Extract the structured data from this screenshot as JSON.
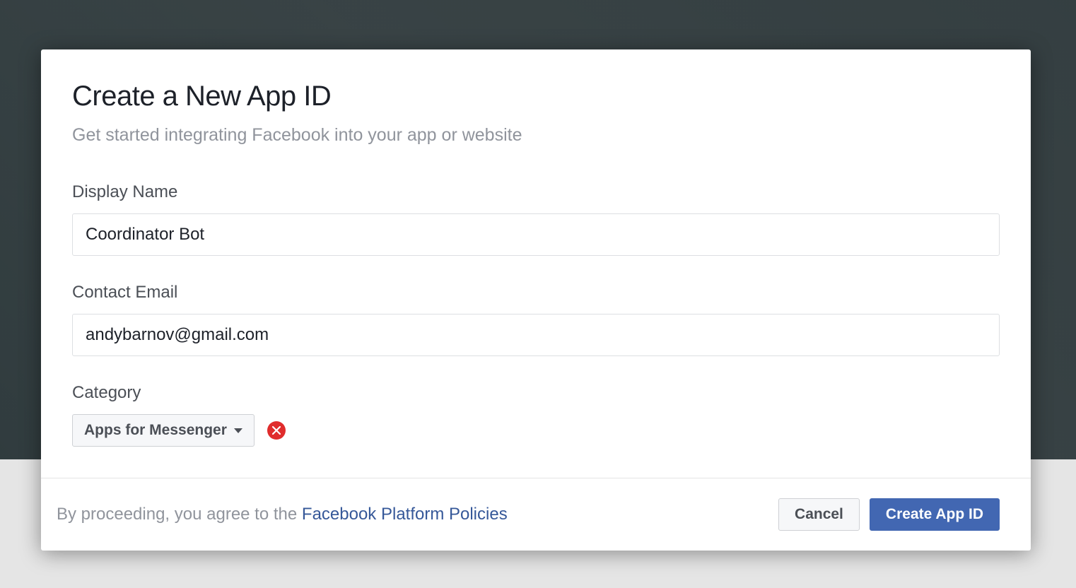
{
  "dialog": {
    "title": "Create a New App ID",
    "subtitle": "Get started integrating Facebook into your app or website",
    "display_name": {
      "label": "Display Name",
      "value": "Coordinator Bot"
    },
    "contact_email": {
      "label": "Contact Email",
      "value": "andybarnov@gmail.com"
    },
    "category": {
      "label": "Category",
      "selected": "Apps for Messenger"
    },
    "footer": {
      "agree_prefix": "By proceeding, you agree to the ",
      "policies_link": "Facebook Platform Policies",
      "cancel_label": "Cancel",
      "create_label": "Create App ID"
    }
  }
}
